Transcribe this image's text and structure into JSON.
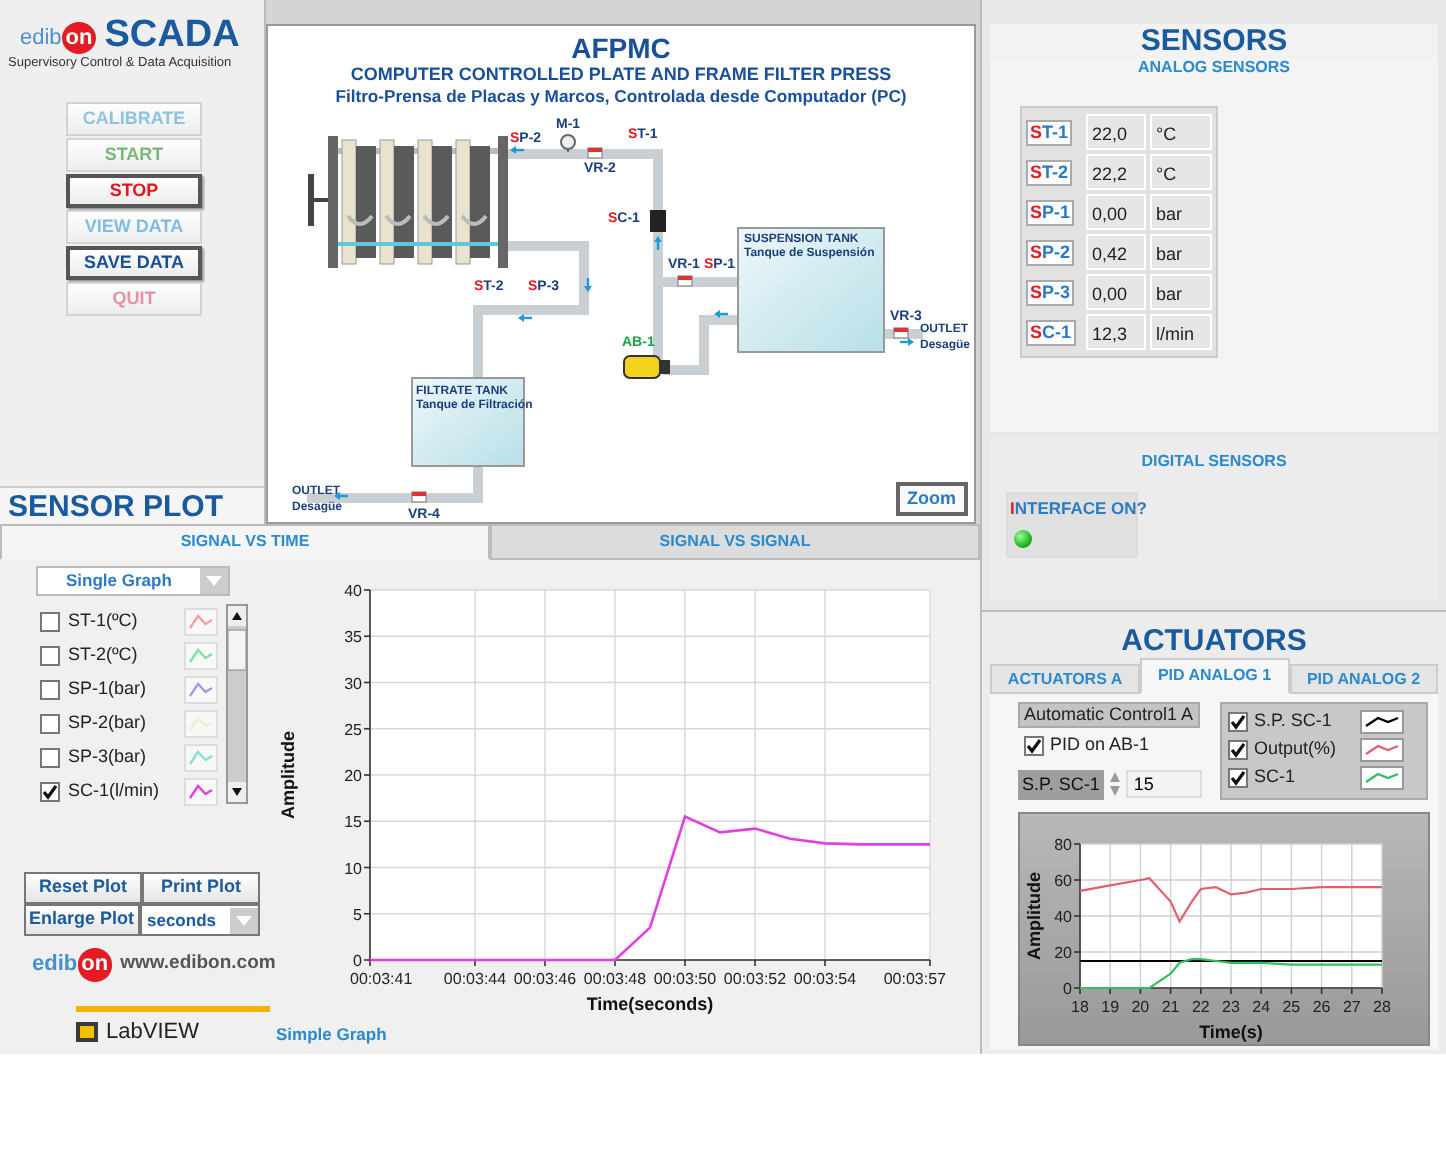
{
  "header": {
    "brand_text": "edib",
    "brand_badge": "on",
    "title": "SCADA",
    "subtitle": "Supervisory Control & Data Acquisition"
  },
  "buttons": [
    {
      "label": "CALIBRATE",
      "disabled": true,
      "color": "#8cc4e2"
    },
    {
      "label": "START",
      "disabled": true,
      "color": "#7ab87a"
    },
    {
      "label": "STOP",
      "disabled": false,
      "color": "#e8141c"
    },
    {
      "label": "VIEW DATA",
      "disabled": true,
      "color": "#80bde0"
    },
    {
      "label": "SAVE DATA",
      "disabled": false,
      "color": "#1a4f9c"
    },
    {
      "label": "QUIT",
      "disabled": true,
      "color": "#e890a6"
    }
  ],
  "sensor_plot_title": "SENSOR PLOT",
  "diagram": {
    "title": "AFPMC",
    "subtitle": "COMPUTER CONTROLLED PLATE AND FRAME FILTER PRESS",
    "subtitle_es": "Filtro-Prensa de Placas y Marcos, Controlada desde Computador (PC)",
    "labels": [
      {
        "text": "SP-2",
        "kind": "sensor"
      },
      {
        "text": "M-1",
        "kind": "valve"
      },
      {
        "text": "ST-1",
        "kind": "sensor"
      },
      {
        "text": "VR-2",
        "kind": "valve"
      },
      {
        "text": "SC-1",
        "kind": "sensor"
      },
      {
        "text": "VR-1",
        "kind": "valve"
      },
      {
        "text": "SP-1",
        "kind": "sensor"
      },
      {
        "text": "SUSPENSION TANK",
        "kind": "tank"
      },
      {
        "text": "Tanque de Suspensión",
        "kind": "tank"
      },
      {
        "text": "ST-2",
        "kind": "sensor"
      },
      {
        "text": "SP-3",
        "kind": "sensor"
      },
      {
        "text": "VR-3",
        "kind": "valve"
      },
      {
        "text": "OUTLET",
        "kind": "outlet"
      },
      {
        "text": "Desagüe",
        "kind": "outlet"
      },
      {
        "text": "AB-1",
        "kind": "actuator"
      },
      {
        "text": "FILTRATE TANK",
        "kind": "tank"
      },
      {
        "text": "Tanque de Filtración",
        "kind": "tank"
      },
      {
        "text": "OUTLET",
        "kind": "outlet"
      },
      {
        "text": "Desagüe",
        "kind": "outlet"
      },
      {
        "text": "VR-4",
        "kind": "valve"
      }
    ],
    "zoom_button": "Zoom"
  },
  "sensors": {
    "title": "SENSORS",
    "analog_title": "ANALOG SENSORS",
    "analog": [
      {
        "tag": "ST-1",
        "value": "22,0",
        "unit": "°C"
      },
      {
        "tag": "ST-2",
        "value": "22,2",
        "unit": "°C"
      },
      {
        "tag": "SP-1",
        "value": "0,00",
        "unit": "bar"
      },
      {
        "tag": "SP-2",
        "value": "0,42",
        "unit": "bar"
      },
      {
        "tag": "SP-3",
        "value": "0,00",
        "unit": "bar"
      },
      {
        "tag": "SC-1",
        "value": "12,3",
        "unit": "l/min"
      }
    ],
    "digital_title": "DIGITAL SENSORS",
    "digital": [
      {
        "label": "INTERFACE ON?",
        "on": true
      }
    ]
  },
  "sensor_plot": {
    "tabs": [
      {
        "label": "SIGNAL VS TIME",
        "selected": true
      },
      {
        "label": "SIGNAL VS SIGNAL",
        "selected": false
      }
    ],
    "graph_mode": "Single Graph",
    "channels": [
      {
        "label": "ST-1(ºC)",
        "checked": false,
        "color": "#f4a0a0"
      },
      {
        "label": "ST-2(ºC)",
        "checked": false,
        "color": "#80e0a0"
      },
      {
        "label": "SP-1(bar)",
        "checked": false,
        "color": "#a898e0"
      },
      {
        "label": "SP-2(bar)",
        "checked": false,
        "color": "#f2f0c8"
      },
      {
        "label": "SP-3(bar)",
        "checked": false,
        "color": "#88e0d4"
      },
      {
        "label": "SC-1(l/min)",
        "checked": true,
        "color": "#e040e0"
      }
    ],
    "buttons": [
      "Reset Plot",
      "Print Plot",
      "Enlarge Plot"
    ],
    "time_unit": "seconds",
    "website_brand_text": "edib",
    "website_brand_badge": "on",
    "website": "www.edibon.com",
    "labview": "LabVIEW",
    "graph_caption": "Simple Graph",
    "chart_data": {
      "type": "line",
      "xlabel": "Time(seconds)",
      "ylabel": "Amplitude",
      "ylim": [
        0,
        40
      ],
      "grid": true,
      "categories": [
        "00:03:41",
        null,
        null,
        "00:03:44",
        null,
        "00:03:46",
        null,
        "00:03:48",
        null,
        "00:03:50",
        null,
        "00:03:52",
        null,
        "00:03:54",
        null,
        null,
        "00:03:57"
      ],
      "yticks": [
        0,
        5,
        10,
        15,
        20,
        25,
        30,
        35,
        40
      ],
      "series": [
        {
          "color": "#e040e0",
          "values": [
            0,
            0,
            0,
            0,
            0,
            0,
            0,
            0,
            3.5,
            15.5,
            13.8,
            14.2,
            13.1,
            12.6,
            12.5,
            12.5,
            12.5
          ]
        }
      ]
    }
  },
  "actuators": {
    "title": "ACTUATORS",
    "tabs": [
      {
        "label": "ACTUATORS A",
        "selected": false
      },
      {
        "label": "PID ANALOG 1",
        "selected": true
      },
      {
        "label": "PID ANALOG 2",
        "selected": false
      }
    ],
    "control_title": "Automatic Control1 A",
    "pid_toggle": {
      "label": "PID on AB-1",
      "checked": true
    },
    "setpoint": {
      "label": "S.P. SC-1",
      "value": "15"
    },
    "legend": [
      {
        "label": "S.P. SC-1",
        "checked": true,
        "color": "#000000"
      },
      {
        "label": "Output(%)",
        "checked": true,
        "color": "#e06070"
      },
      {
        "label": "SC-1",
        "checked": true,
        "color": "#30c060"
      }
    ],
    "chart_data": {
      "type": "line",
      "xlabel": "Time(s)",
      "ylabel": "Amplitude",
      "xlim": [
        18,
        28
      ],
      "ylim": [
        0,
        80
      ],
      "grid": true,
      "xticks": [
        18,
        19,
        20,
        21,
        22,
        23,
        24,
        25,
        26,
        27,
        28
      ],
      "yticks": [
        0,
        20,
        40,
        60,
        80
      ],
      "x": [
        18,
        19,
        20,
        20.3,
        21,
        21.3,
        21.7,
        22,
        22.5,
        23,
        23.5,
        24,
        25,
        26,
        28
      ],
      "series": [
        {
          "color": "#000000",
          "values": [
            15,
            15,
            15,
            15,
            15,
            15,
            15,
            15,
            15,
            15,
            15,
            15,
            15,
            15,
            15
          ]
        },
        {
          "color": "#e06070",
          "values": [
            54,
            57,
            60,
            61,
            48,
            37,
            48,
            55,
            56,
            52,
            53,
            55,
            55,
            56,
            56
          ]
        },
        {
          "color": "#30c060",
          "values": [
            0,
            0,
            0,
            0,
            8,
            14,
            16,
            16,
            15,
            14,
            14,
            14,
            13,
            13,
            13
          ]
        }
      ]
    }
  }
}
